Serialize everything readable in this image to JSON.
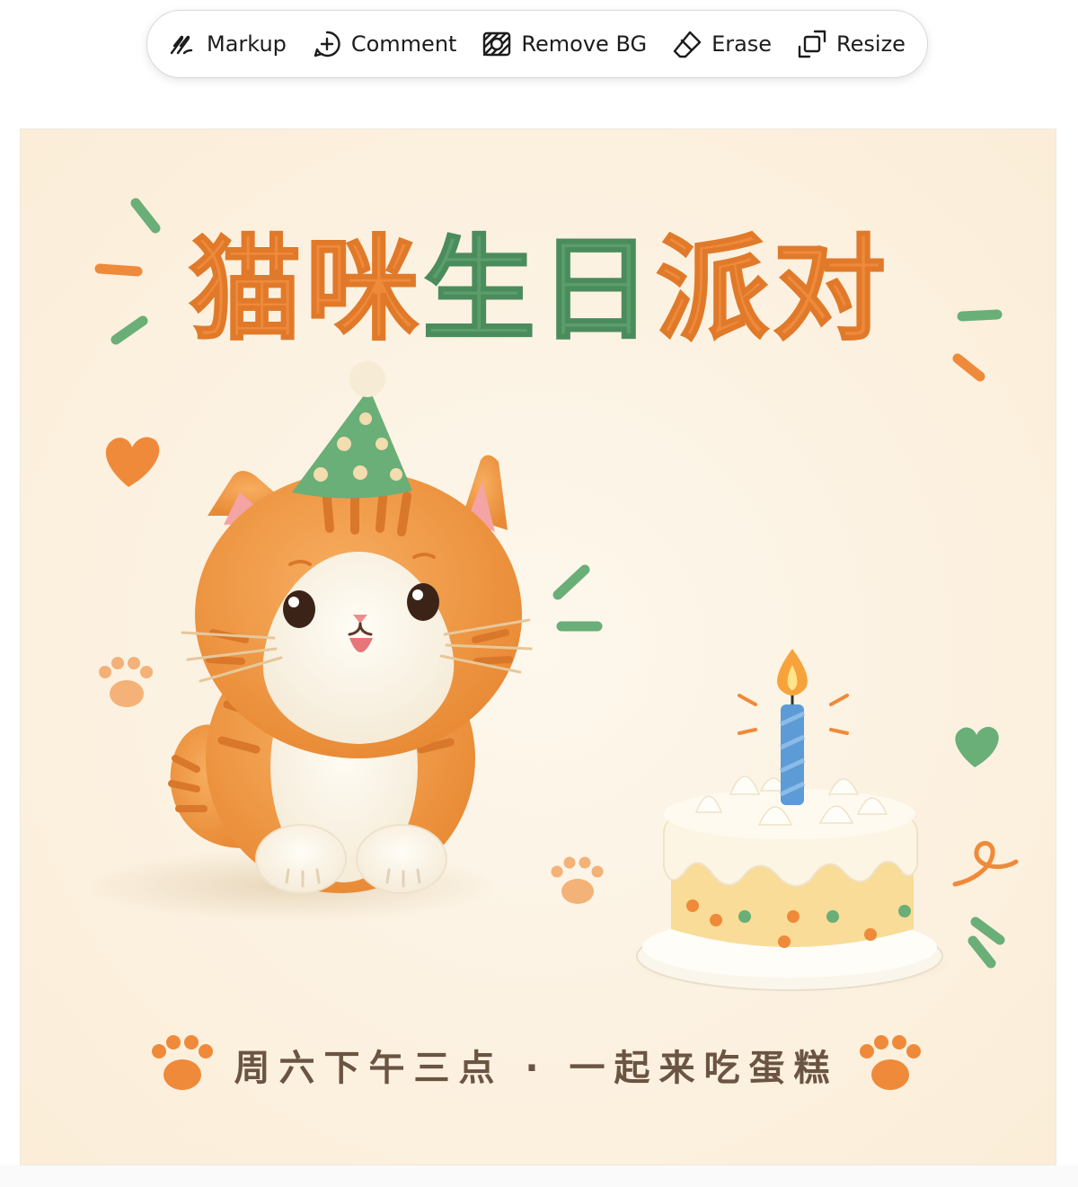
{
  "toolbar": {
    "items": [
      {
        "label": "Markup",
        "icon": "markup-pen-icon"
      },
      {
        "label": "Comment",
        "icon": "comment-plus-icon"
      },
      {
        "label": "Remove BG",
        "icon": "remove-background-icon"
      },
      {
        "label": "Erase",
        "icon": "eraser-icon"
      },
      {
        "label": "Resize",
        "icon": "resize-icon"
      }
    ]
  },
  "image": {
    "title": "猫咪生日派对",
    "caption": "周六下午三点 · 一起来吃蛋糕",
    "colors": {
      "background": "#fdf4e6",
      "orange": "#ef8a3a",
      "green": "#5fa36f",
      "text_brown": "#6b5442"
    }
  }
}
